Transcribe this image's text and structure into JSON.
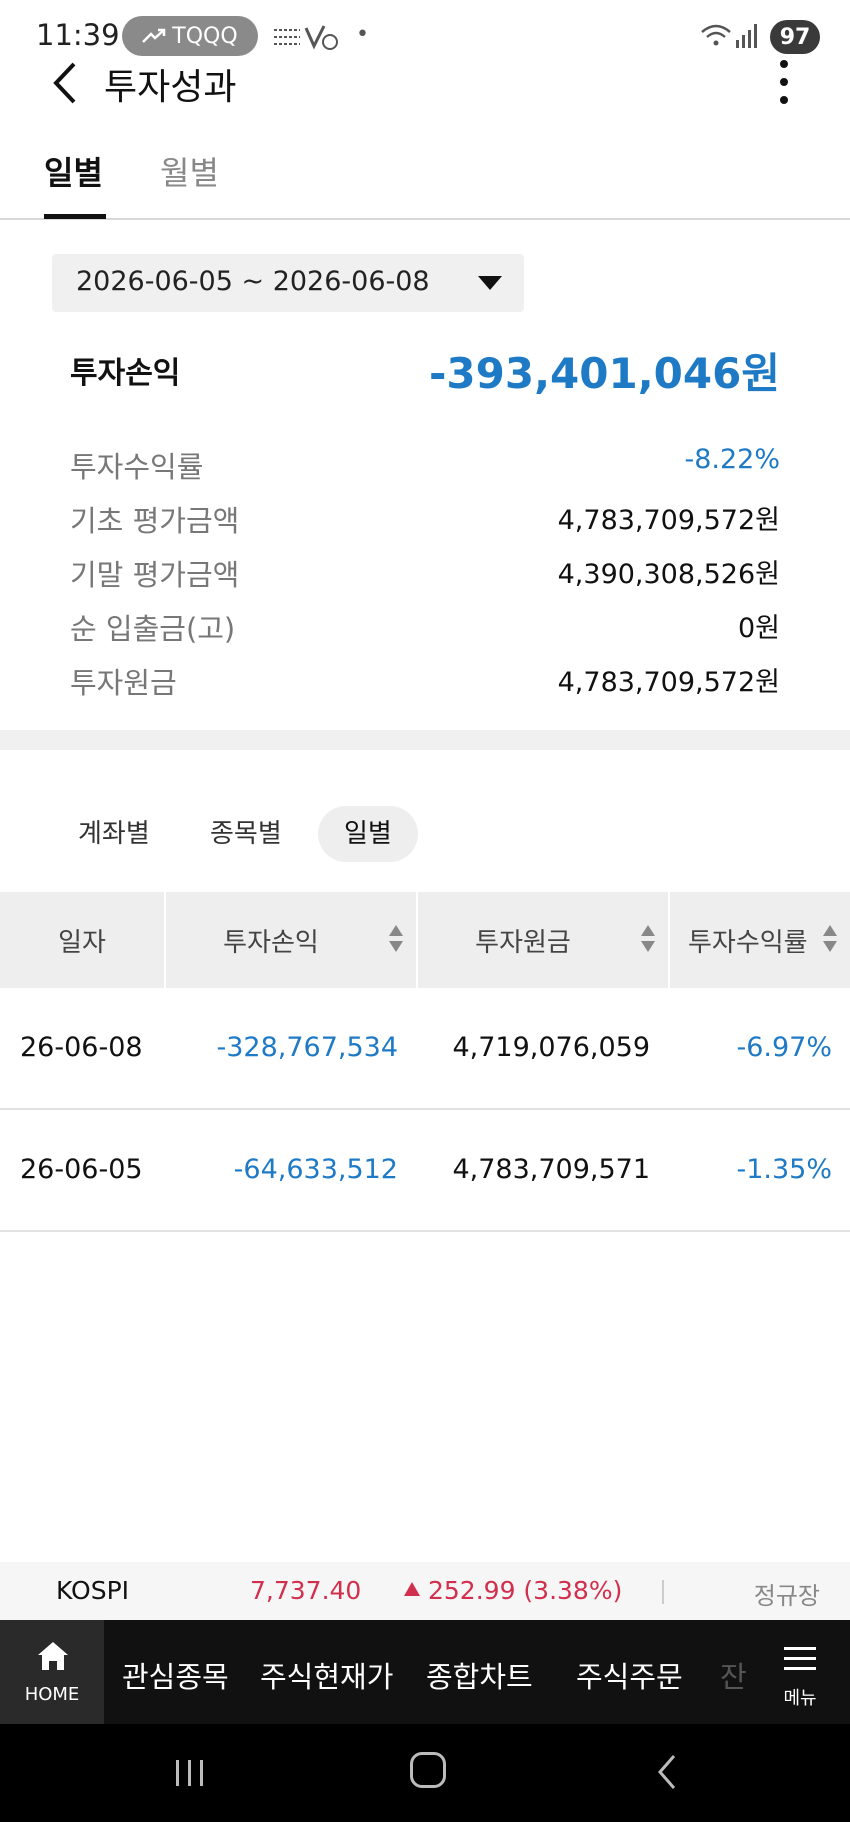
{
  "status_bar": {
    "time": "11:39",
    "chip_label": "TQQQ",
    "signal_text": "5",
    "battery": "97"
  },
  "header": {
    "title": "투자성과"
  },
  "period_tabs": [
    {
      "label": "일별",
      "active": true
    },
    {
      "label": "월별",
      "active": false
    }
  ],
  "date_range": "2026-06-05 ~ 2026-06-08",
  "summary": {
    "title": "투자손익",
    "total": "-393,401,046원",
    "rows": [
      {
        "label": "투자수익률",
        "value": "-8.22%"
      },
      {
        "label": "기초 평가금액",
        "value": "4,783,709,572원"
      },
      {
        "label": "기말 평가금액",
        "value": "4,390,308,526원"
      },
      {
        "label": "순 입출금(고)",
        "value": "0원"
      },
      {
        "label": "투자원금",
        "value": "4,783,709,572원"
      }
    ]
  },
  "sub_tabs": [
    {
      "label": "계좌별",
      "active": false
    },
    {
      "label": "종목별",
      "active": false
    },
    {
      "label": "일별",
      "active": true
    }
  ],
  "table": {
    "columns": [
      "일자",
      "투자손익",
      "투자원금",
      "투자수익률"
    ],
    "rows": [
      {
        "date": "26-06-08",
        "pnl": "-328,767,534",
        "principal": "4,719,076,059",
        "rate": "-6.97%"
      },
      {
        "date": "26-06-05",
        "pnl": "-64,633,512",
        "principal": "4,783,709,571",
        "rate": "-1.35%"
      }
    ]
  },
  "ticker": {
    "name": "KOSPI",
    "value": "7,737.40",
    "change": "252.99 (3.38%)",
    "session": "정규장"
  },
  "bottom_nav": {
    "home_label": "HOME",
    "items": [
      "관심종목",
      "주식현재가",
      "종합차트",
      "주식주문",
      "잔"
    ],
    "menu_label": "메뉴"
  },
  "colors": {
    "loss_blue": "#1f7ac6",
    "rise_red": "#d0304e"
  }
}
